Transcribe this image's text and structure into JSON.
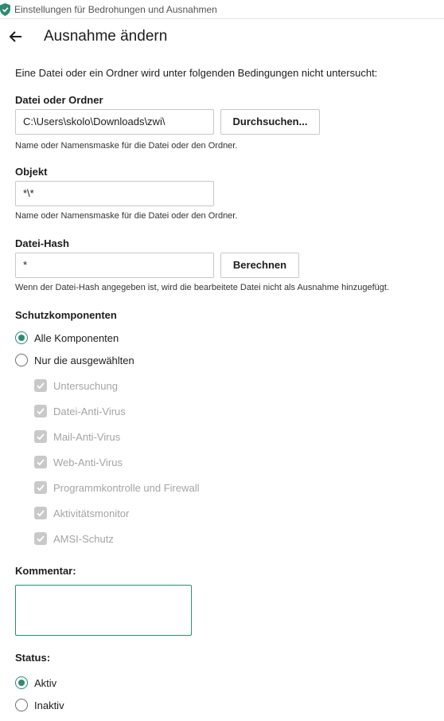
{
  "window": {
    "title": "Einstellungen für Bedrohungen und Ausnahmen"
  },
  "header": {
    "title": "Ausnahme ändern"
  },
  "intro": "Eine Datei oder ein Ordner wird unter folgenden Bedingungen nicht untersucht:",
  "file_or_folder": {
    "label": "Datei oder Ordner",
    "value": "C:\\Users\\skolo\\Downloads\\zwi\\",
    "browse_label": "Durchsuchen...",
    "hint": "Name oder Namensmaske für die Datei oder den Ordner."
  },
  "object": {
    "label": "Objekt",
    "value": "*\\*",
    "hint": "Name oder Namensmaske für die Datei oder den Ordner."
  },
  "file_hash": {
    "label": "Datei-Hash",
    "value": "*",
    "compute_label": "Berechnen",
    "hint": "Wenn der Datei-Hash angegeben ist, wird die bearbeitete Datei nicht als Ausnahme hinzugefügt."
  },
  "protection": {
    "label": "Schutzkomponenten",
    "options": [
      {
        "label": "Alle Komponenten",
        "selected": true
      },
      {
        "label": "Nur die ausgewählten",
        "selected": false
      }
    ],
    "components": [
      {
        "label": "Untersuchung",
        "checked": true
      },
      {
        "label": "Datei-Anti-Virus",
        "checked": true
      },
      {
        "label": "Mail-Anti-Virus",
        "checked": true
      },
      {
        "label": "Web-Anti-Virus",
        "checked": true
      },
      {
        "label": "Programmkontrolle und Firewall",
        "checked": true
      },
      {
        "label": "Aktivitätsmonitor",
        "checked": true
      },
      {
        "label": "AMSI-Schutz",
        "checked": true
      }
    ]
  },
  "comment": {
    "label": "Kommentar:",
    "value": ""
  },
  "status": {
    "label": "Status:",
    "options": [
      {
        "label": "Aktiv",
        "selected": true
      },
      {
        "label": "Inaktiv",
        "selected": false
      }
    ]
  },
  "colors": {
    "accent": "#2e8b73",
    "disabled_text": "#a4a4a4",
    "disabled_check": "#c9c9c9"
  },
  "icons": {
    "window": "shield-check-icon",
    "back": "arrow-left-icon",
    "check": "checkmark-icon"
  }
}
